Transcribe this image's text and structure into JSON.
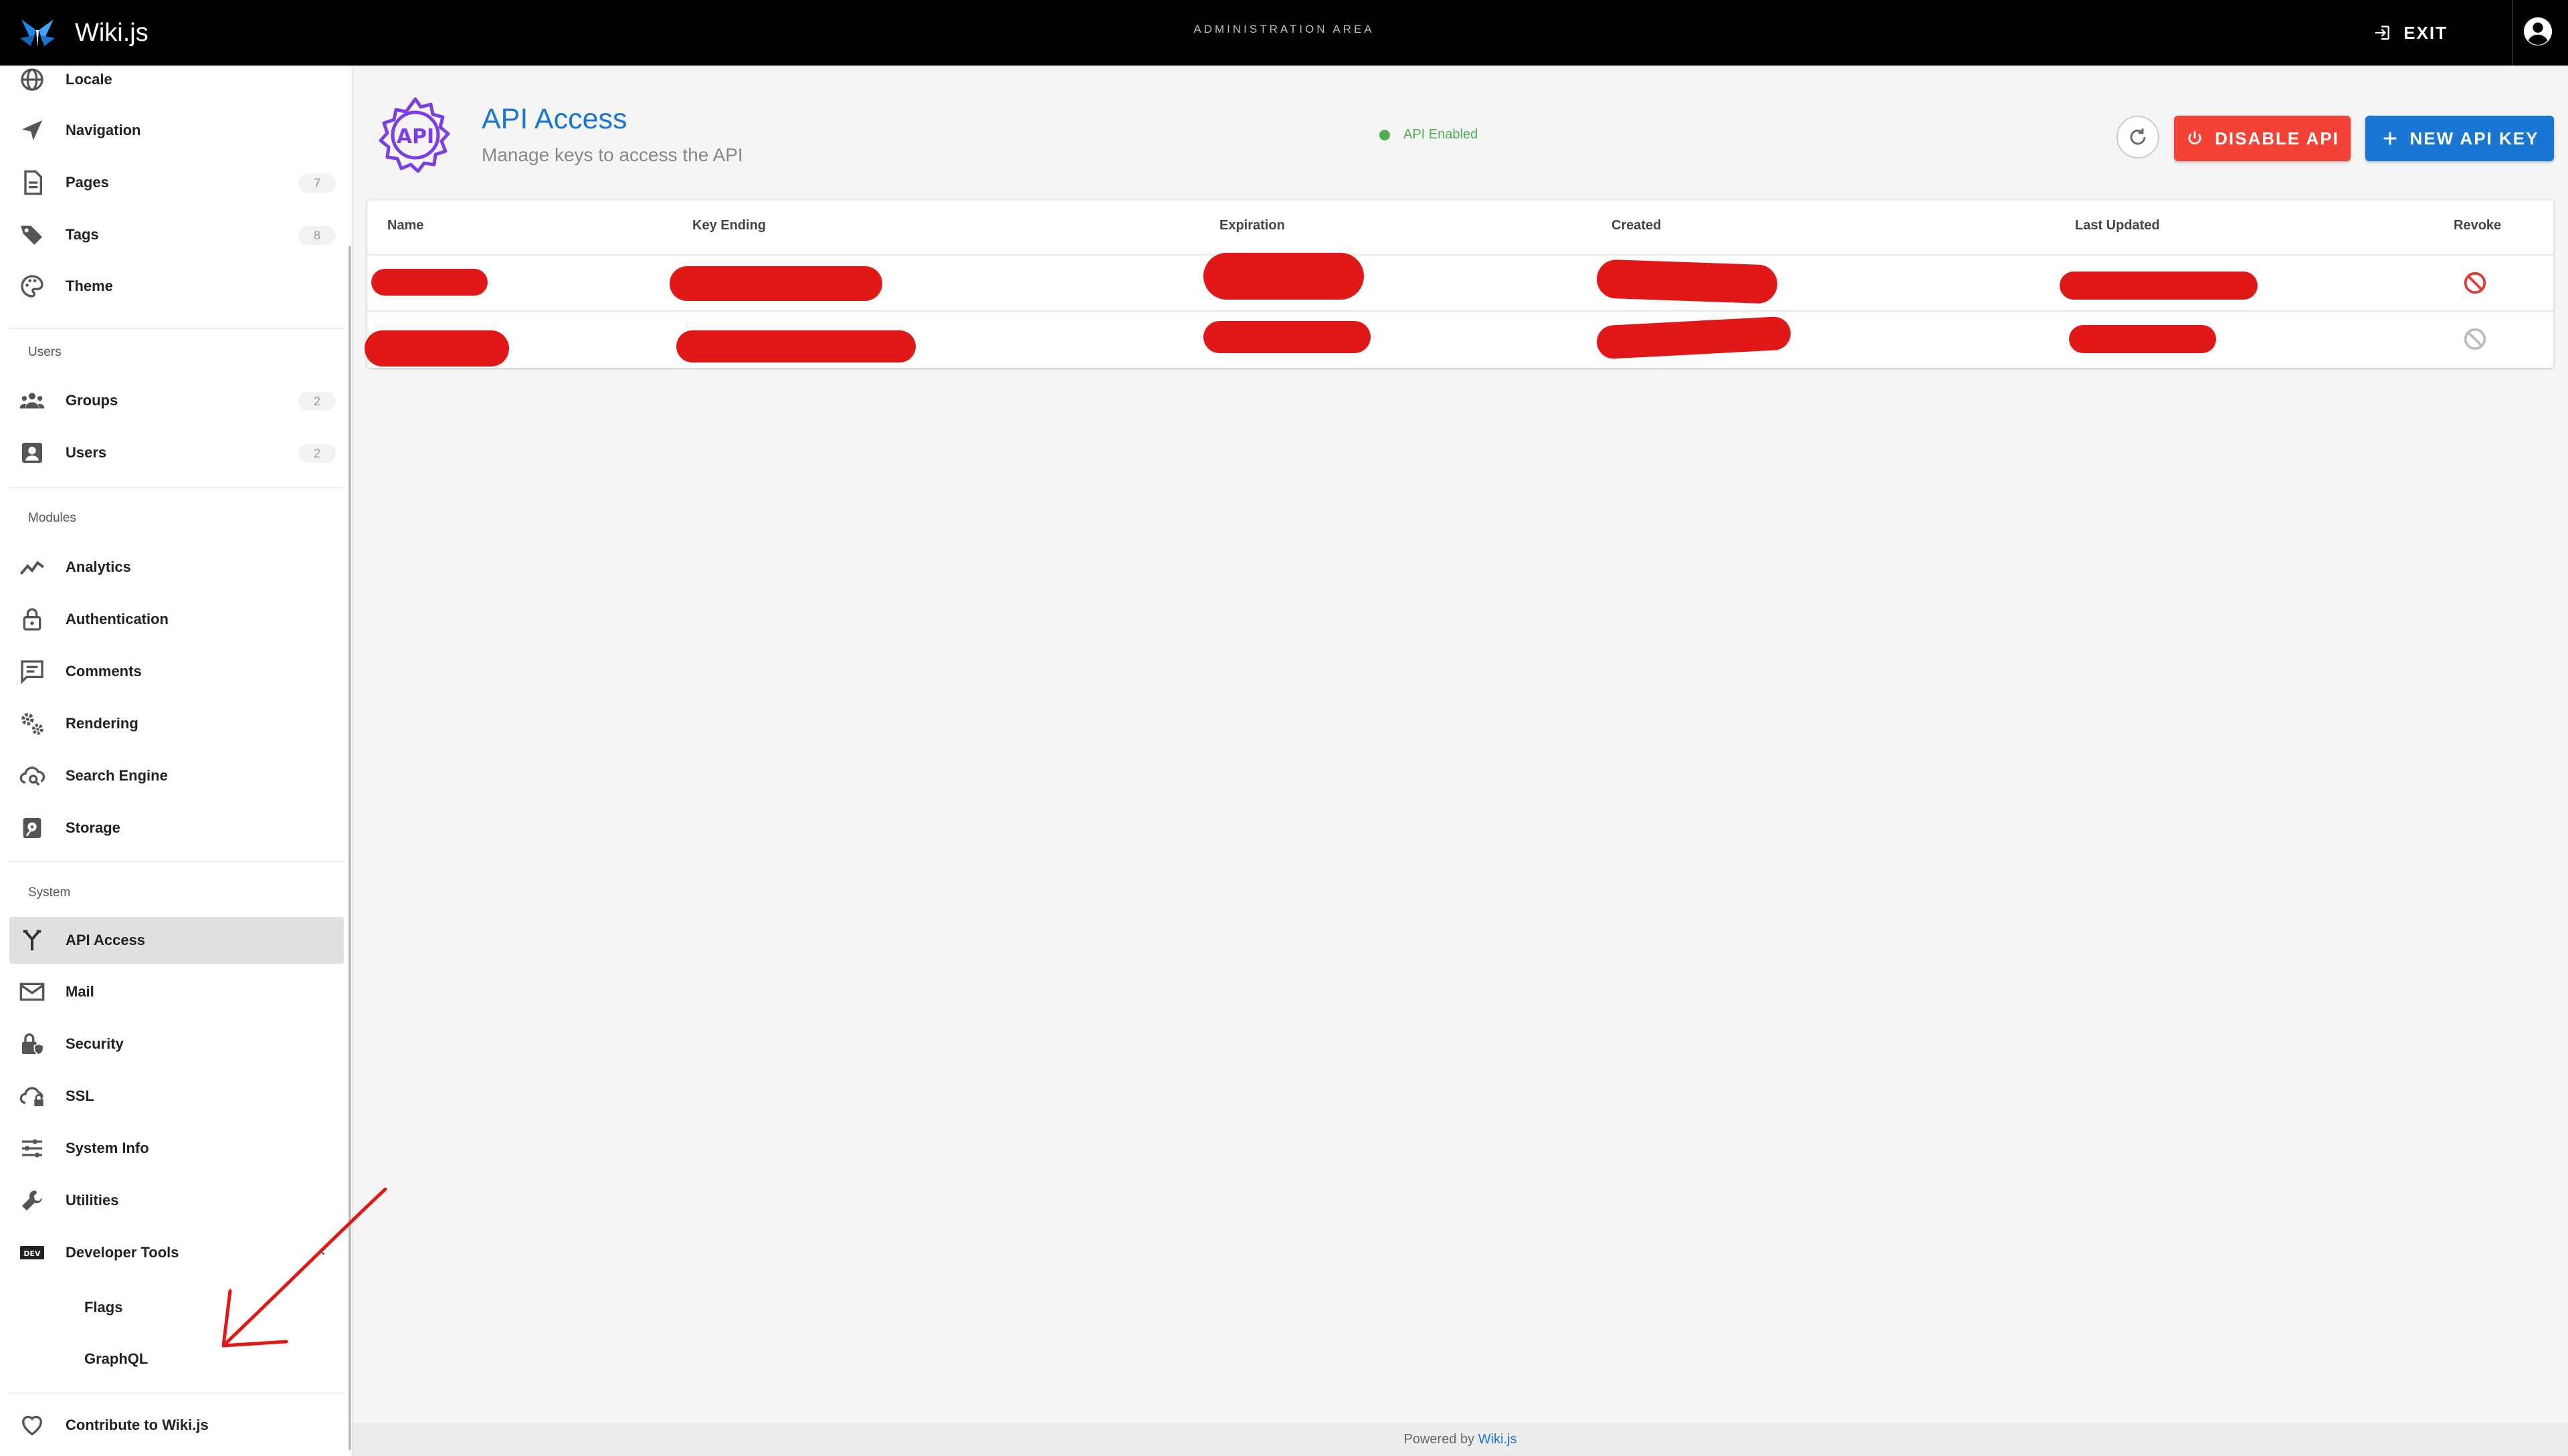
{
  "topbar": {
    "brand_title": "Wiki.js",
    "admin_title": "ADMINISTRATION AREA",
    "exit_label": "EXIT"
  },
  "sidebar": {
    "items_top": [
      {
        "label": "Locale",
        "icon": "globe-icon"
      },
      {
        "label": "Navigation",
        "icon": "navigation-icon"
      },
      {
        "label": "Pages",
        "icon": "pages-icon",
        "badge": "7"
      },
      {
        "label": "Tags",
        "icon": "tags-icon",
        "badge": "8"
      },
      {
        "label": "Theme",
        "icon": "palette-icon"
      }
    ],
    "section_users": "Users",
    "items_users": [
      {
        "label": "Groups",
        "icon": "groups-icon",
        "badge": "2"
      },
      {
        "label": "Users",
        "icon": "user-icon",
        "badge": "2"
      }
    ],
    "section_modules": "Modules",
    "items_modules": [
      {
        "label": "Analytics",
        "icon": "analytics-icon"
      },
      {
        "label": "Authentication",
        "icon": "lock-icon"
      },
      {
        "label": "Comments",
        "icon": "comments-icon"
      },
      {
        "label": "Rendering",
        "icon": "gears-icon"
      },
      {
        "label": "Search Engine",
        "icon": "cloud-search-icon"
      },
      {
        "label": "Storage",
        "icon": "storage-icon"
      }
    ],
    "section_system": "System",
    "items_system": [
      {
        "label": "API Access",
        "icon": "api-icon",
        "active": true
      },
      {
        "label": "Mail",
        "icon": "mail-icon"
      },
      {
        "label": "Security",
        "icon": "security-icon"
      },
      {
        "label": "SSL",
        "icon": "cloud-lock-icon"
      },
      {
        "label": "System Info",
        "icon": "sliders-icon"
      },
      {
        "label": "Utilities",
        "icon": "wrench-icon"
      },
      {
        "label": "Developer Tools",
        "icon": "dev-icon"
      }
    ],
    "dev_sub_items": [
      "Flags",
      "GraphQL"
    ],
    "contribute_label": "Contribute to Wiki.js"
  },
  "main": {
    "title": "API Access",
    "subtitle": "Manage keys to access the API",
    "status_text": "API Enabled",
    "disable_label": "DISABLE API",
    "new_key_label": "NEW API KEY",
    "table": {
      "headers": [
        "Name",
        "Key Ending",
        "Expiration",
        "Created",
        "Last Updated",
        "Revoke"
      ],
      "rows": [
        {
          "revoke_state": "active"
        },
        {
          "revoke_state": "disabled"
        }
      ]
    }
  },
  "footer": {
    "prefix": "Powered by",
    "link_label": "Wiki.js"
  },
  "colors": {
    "primary": "#1976d2",
    "danger": "#f44336",
    "success": "#4caf50",
    "redaction": "#e01818",
    "api_icon": "#7b3fe4"
  }
}
